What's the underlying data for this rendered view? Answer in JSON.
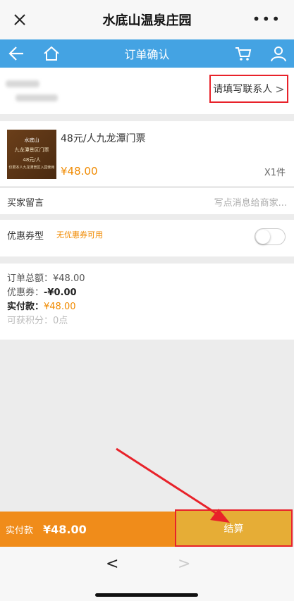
{
  "window": {
    "title": "水底山温泉庄园"
  },
  "nav": {
    "title": "订单确认"
  },
  "contact": {
    "link_label": "请填写联系人"
  },
  "product": {
    "ticket_logo": "水底山",
    "ticket_line1": "九龙潭景区门票",
    "ticket_line2": "48元/人",
    "ticket_line3": "仅限本人九龙潭景区入园使用",
    "name": "48元/人九龙潭门票",
    "price": "¥48.00",
    "quantity": "X1件"
  },
  "message": {
    "label": "买家留言",
    "placeholder": "写点消息给商家..."
  },
  "coupon": {
    "label": "优惠券型",
    "note": "无优惠券可用"
  },
  "summary": {
    "total_label": "订单总额：",
    "total_value": "¥48.00",
    "coupon_label": "优惠券：",
    "coupon_value": "-¥0.00",
    "paid_label": "实付款：",
    "paid_value": "¥48.00",
    "points_label": "可获积分：",
    "points_value": "0点"
  },
  "bottom": {
    "pay_label": "实付款",
    "pay_amount": "¥48.00",
    "checkout_label": "结算"
  },
  "colors": {
    "nav_blue": "#44a3e3",
    "orange": "#f08c1a",
    "checkout": "#e6ad36",
    "highlight": "#e8222a"
  }
}
